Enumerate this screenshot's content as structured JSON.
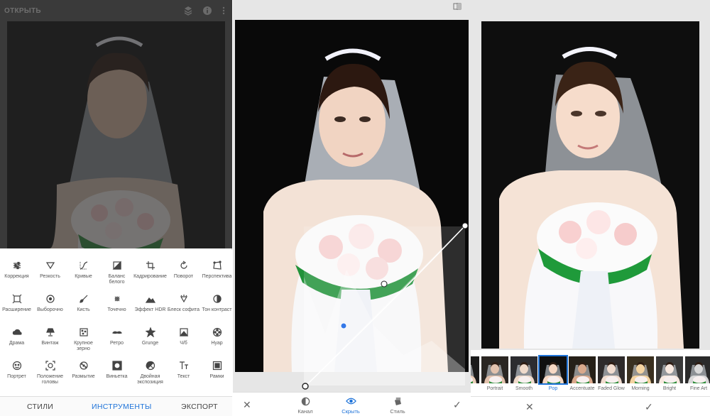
{
  "panel1": {
    "title": "ОТКРЫТЬ",
    "tools": [
      {
        "label": "Коррекция",
        "icon": "sliders-icon"
      },
      {
        "label": "Резкость",
        "icon": "triangle-down-icon"
      },
      {
        "label": "Кривые",
        "icon": "curves-icon"
      },
      {
        "label": "Баланс белого",
        "icon": "white-balance-icon"
      },
      {
        "label": "Кадрирование",
        "icon": "crop-icon"
      },
      {
        "label": "Поворот",
        "icon": "rotate-icon"
      },
      {
        "label": "Перспектива",
        "icon": "perspective-icon"
      },
      {
        "label": "Расширение",
        "icon": "expand-icon"
      },
      {
        "label": "Выборочно",
        "icon": "target-icon"
      },
      {
        "label": "Кисть",
        "icon": "brush-icon"
      },
      {
        "label": "Точечно",
        "icon": "healing-icon"
      },
      {
        "label": "Эффект HDR",
        "icon": "mountains-icon"
      },
      {
        "label": "Блеск софита",
        "icon": "glamour-icon"
      },
      {
        "label": "Тон контраст",
        "icon": "tonal-contrast-icon"
      },
      {
        "label": "Драма",
        "icon": "cloud-icon"
      },
      {
        "label": "Винтаж",
        "icon": "lamp-icon"
      },
      {
        "label": "Крупное зерно",
        "icon": "grain-icon"
      },
      {
        "label": "Ретро",
        "icon": "mustache-icon"
      },
      {
        "label": "Grunge",
        "icon": "grunge-icon"
      },
      {
        "label": "Ч/б",
        "icon": "black-white-icon"
      },
      {
        "label": "Нуар",
        "icon": "film-reel-icon"
      },
      {
        "label": "Портрет",
        "icon": "portrait-icon"
      },
      {
        "label": "Положение головы",
        "icon": "face-frame-icon"
      },
      {
        "label": "Размытие",
        "icon": "lens-blur-icon"
      },
      {
        "label": "Виньетка",
        "icon": "vignette-icon"
      },
      {
        "label": "Двойная экспозиция",
        "icon": "double-exposure-icon"
      },
      {
        "label": "Текст",
        "icon": "text-icon"
      },
      {
        "label": "Рамки",
        "icon": "frame-icon"
      }
    ],
    "bottom_tabs": [
      {
        "label": "СТИЛИ",
        "active": false
      },
      {
        "label": "ИНСТРУМЕНТЫ",
        "active": true
      },
      {
        "label": "ЭКСПОРТ",
        "active": false
      }
    ]
  },
  "panel2": {
    "bottom": {
      "channel": "Канал",
      "hide": "Скрыть",
      "style": "Стиль"
    }
  },
  "panel3": {
    "filters": [
      {
        "label": ""
      },
      {
        "label": "Portrait"
      },
      {
        "label": "Smooth"
      },
      {
        "label": "Pop",
        "active": true
      },
      {
        "label": "Accentuate"
      },
      {
        "label": "Faded Glow"
      },
      {
        "label": "Morning"
      },
      {
        "label": "Bright"
      },
      {
        "label": "Fine Art"
      }
    ]
  },
  "colors": {
    "accent": "#1e73d9"
  }
}
